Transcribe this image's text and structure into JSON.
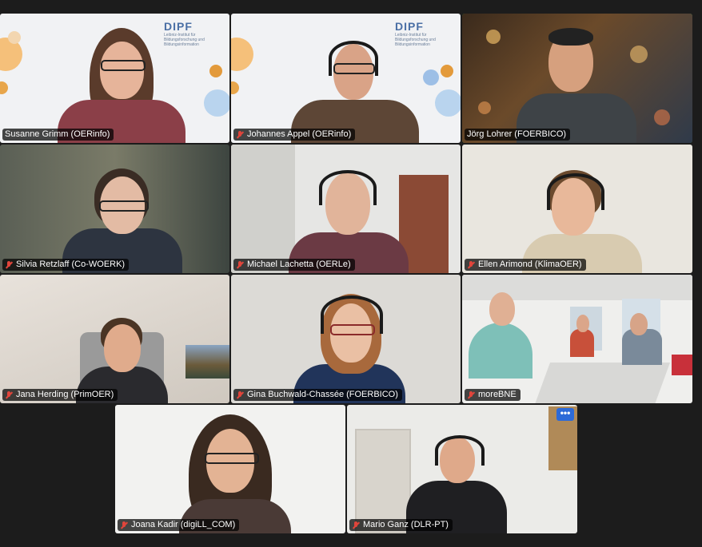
{
  "meeting": {
    "participants": [
      {
        "name": "Susanne Grimm (OERinfo)",
        "muted": false
      },
      {
        "name": "Johannes Appel (OERinfo)",
        "muted": true
      },
      {
        "name": "Jörg Lohrer (FOERBICO)",
        "muted": false,
        "active_speaker": true
      },
      {
        "name": "Silvia Retzlaff (Co-WOERK)",
        "muted": true
      },
      {
        "name": "Michael Lachetta (OERLe)",
        "muted": true
      },
      {
        "name": "Ellen Arimond (KlimaOER)",
        "muted": true
      },
      {
        "name": "Jana Herding (PrimOER)",
        "muted": true
      },
      {
        "name": "Gina Buchwald-Chassée (FOERBICO)",
        "muted": true
      },
      {
        "name": "moreBNE",
        "muted": true
      },
      {
        "name": "Joana Kadir (digiLL_COM)",
        "muted": true
      },
      {
        "name": "Mario Ganz (DLR-PT)",
        "muted": true
      }
    ],
    "logo_text": "DIPF",
    "logo_subtext": "Leibniz-Institut für Bildungsforschung und Bildungsinformation",
    "more_button": "•••",
    "colors": {
      "active_border": "#2ea043",
      "mute_icon": "#e0453b",
      "more_button": "#2d6ad8"
    }
  }
}
